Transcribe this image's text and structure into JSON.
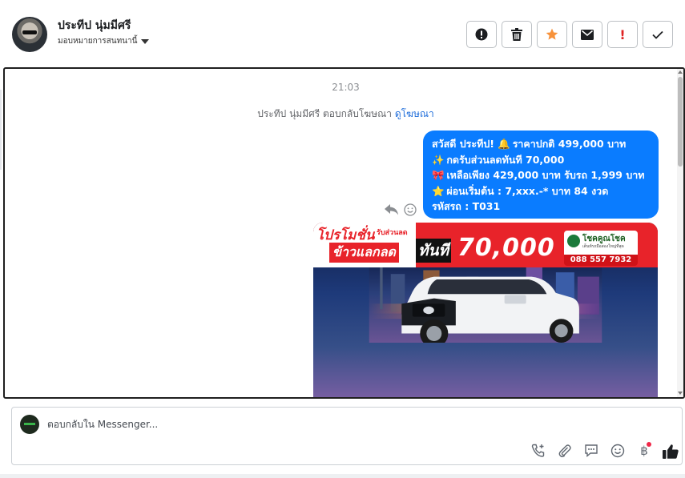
{
  "header": {
    "contact_name": "ประทีป นุ่มมีศรี",
    "assign_label": "มอบหมายการสนทนานี้",
    "actions": [
      {
        "name": "report-spam",
        "icon": "alert-circle-icon"
      },
      {
        "name": "delete",
        "icon": "trash-icon"
      },
      {
        "name": "star",
        "icon": "star-icon"
      },
      {
        "name": "mark-unread",
        "icon": "envelope-icon"
      },
      {
        "name": "important",
        "icon": "exclamation-icon",
        "glyph": "!"
      },
      {
        "name": "done",
        "icon": "checkmark-icon"
      }
    ]
  },
  "conversation": {
    "timestamp": "21:03",
    "notice_text": "ประทีป นุ่มมีศรี ตอบกลับโฆษณา",
    "notice_link": "ดูโฆษณา",
    "message": {
      "lines": [
        {
          "text": "สวัสดี ประทีป! ",
          "emoji": "🔔",
          "rest": " ราคาปกติ  499,000 บาท"
        },
        {
          "emoji": "✨",
          "text": " กดรับส่วนลดทันที 70,000"
        },
        {
          "emoji": "🎀",
          "text": "  เหลือเพียง 429,000 บาท รับรถ 1,999 บาท"
        },
        {
          "emoji": "⭐",
          "text": " ผ่อนเริ่มต้น : 7,xxx.-* บาท 84 งวด"
        },
        {
          "text": "รหัสรถ : T031"
        }
      ]
    },
    "promo": {
      "title_line1": "โปรโมชั่น",
      "subtitle": "รับส่วนลด",
      "title_line2": "ข้าวแลกลด",
      "now_label": "ทันที",
      "amount": "70,000",
      "logo_name": "โชคคูณโชค",
      "logo_tagline": "เต็นท์รถมือสองใหญ่ที่สุด",
      "phone": "088 557 7932"
    }
  },
  "composer": {
    "placeholder": "ตอบกลับใน Messenger...",
    "tools": [
      "add-call-icon",
      "attachment-icon",
      "saved-replies-icon",
      "emoji-icon",
      "payment-icon",
      "like-icon"
    ],
    "payment_glyph": "฿"
  },
  "colors": {
    "bubble": "#0a7cff",
    "accent_star": "#f7923b",
    "important": "#e02424",
    "promo_red": "#e8232a"
  }
}
